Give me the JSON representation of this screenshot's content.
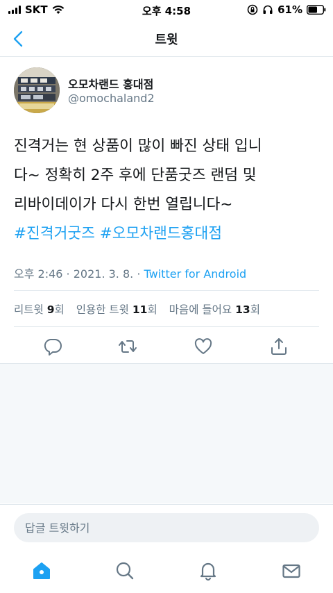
{
  "status_bar": {
    "carrier": "SKT",
    "time": "오후 4:58",
    "battery": "61%"
  },
  "nav": {
    "title": "트윗",
    "back_icon": "chevron-left-icon"
  },
  "author": {
    "display_name": "오모차랜드 홍대점",
    "handle": "@omochaland2"
  },
  "tweet": {
    "line1": "진격거는 현 상품이 많이 빠진 상태 입니",
    "line2": "다~ 정확히 2주 후에 단품굿즈 랜덤 및",
    "line3": "리바이데이가 다시 한번 열립니다~",
    "hashtag1": "#진격거굿즈",
    "hashtag2": "#오모차랜드홍대점"
  },
  "meta": {
    "time": "오후 2:46",
    "separator1": " · ",
    "date": "2021. 3. 8.",
    "separator2": " · ",
    "source": "Twitter for Android"
  },
  "stats": {
    "retweets_label": "리트윗",
    "retweets_count": "9",
    "retweets_unit": "회",
    "quotes_label": "인용한 트윗",
    "quotes_count": "11",
    "quotes_unit": "회",
    "likes_label": "마음에 들어요",
    "likes_count": "13",
    "likes_unit": "회"
  },
  "actions": [
    "reply-icon",
    "retweet-icon",
    "like-icon",
    "share-icon"
  ],
  "reply": {
    "placeholder": "답글 트윗하기"
  },
  "tabs": [
    "home-icon",
    "search-icon",
    "notifications-icon",
    "messages-icon"
  ],
  "colors": {
    "accent": "#1da1f2",
    "secondary_text": "#657786",
    "divider": "#e1e8ed"
  }
}
